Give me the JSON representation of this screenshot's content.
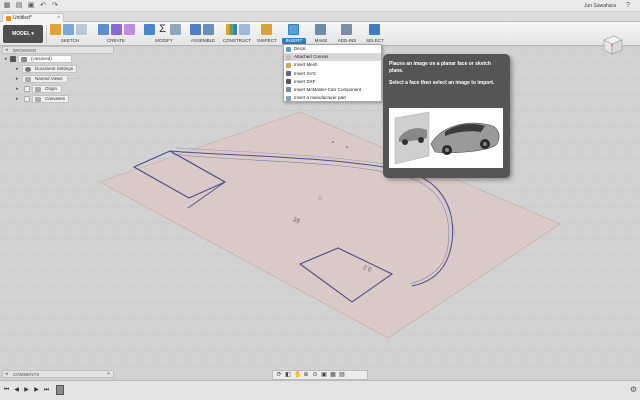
{
  "app_bar": {
    "user_name": "Jun Sawahara",
    "help_label": "?"
  },
  "document_tab": {
    "title": "Untitled*"
  },
  "toolbar": {
    "workspace": "MODEL",
    "groups": [
      "SKETCH",
      "CREATE",
      "MODIFY",
      "ASSEMBLE",
      "CONSTRUCT",
      "INSPECT",
      "INSERT",
      "MAKE",
      "ADD-INS",
      "SELECT"
    ]
  },
  "browser": {
    "header": "BROWSER",
    "root": "(Unsaved)",
    "items": [
      "Document Settings",
      "Named Views",
      "Origin",
      "Canvases"
    ]
  },
  "insert_menu": {
    "items": [
      "Decal",
      "Attached Canvas",
      "Insert Mesh",
      "Insert SVG",
      "Insert DXF",
      "Insert McMaster-Carr Component",
      "Insert a manufacturer part"
    ]
  },
  "tooltip": {
    "description": "Places an image on a planar face or sketch plane.",
    "hint": "Select a face then select an image to import."
  },
  "comments": {
    "header": "COMMENTS"
  },
  "colors": {
    "accent": "#2f7fc2",
    "toolbar_bg": "#ececec",
    "tooltip_bg": "#555555",
    "canvas_plane": "#d9c9c5"
  }
}
